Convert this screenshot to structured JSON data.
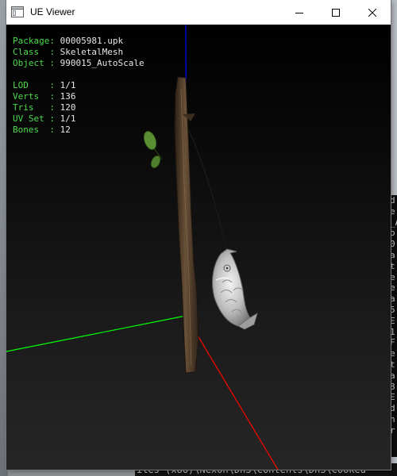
{
  "window": {
    "title": "UE Viewer",
    "controls": {
      "minimize_icon": "minimize-icon",
      "maximize_icon": "maximize-icon",
      "close_icon": "close-icon"
    }
  },
  "info_panel": {
    "group1": [
      {
        "label": "Package: ",
        "value": "00005981.upk"
      },
      {
        "label": "Class  : ",
        "value": "SkeletalMesh"
      },
      {
        "label": "Object : ",
        "value": "990015_AutoScale"
      }
    ],
    "group2": [
      {
        "label": "LOD    : ",
        "value": "1/1"
      },
      {
        "label": "Verts  : ",
        "value": "136"
      },
      {
        "label": "Tris   : ",
        "value": "120"
      },
      {
        "label": "UV Set : ",
        "value": "1/1"
      },
      {
        "label": "Bones  : ",
        "value": "12"
      }
    ]
  },
  "colors": {
    "label": "#4cdc4c",
    "value": "#e6e6e6",
    "axis_x": "#ff0000",
    "axis_y": "#00ff00",
    "axis_z": "#0000ff"
  },
  "background": {
    "console_fragments": [
      "d",
      "e",
      "_A",
      "",
      "o",
      "0",
      "a",
      "t",
      "e",
      "",
      "e",
      "a",
      "5",
      "",
      "E",
      "1",
      "F",
      "",
      "e",
      "t",
      "",
      "a",
      "8",
      "E",
      "",
      "d",
      "n",
      "r"
    ],
    "status_line": "iles (x86)\\Nexon\\DnS\\Contents\\DnS\\Cooked"
  }
}
